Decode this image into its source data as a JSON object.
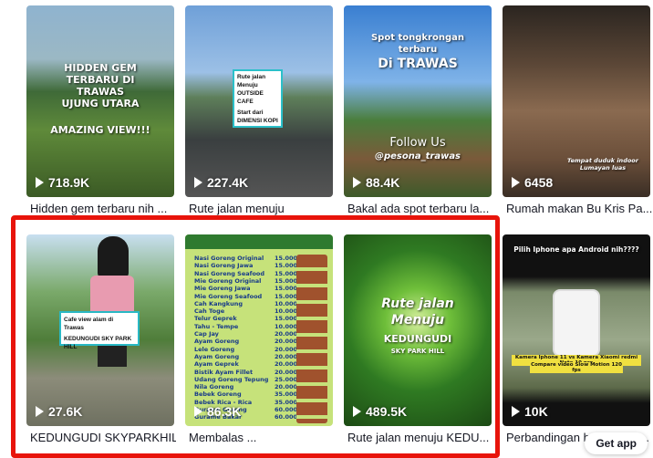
{
  "videos": [
    {
      "views": "718.9K",
      "caption": "Hidden gem terbaru nih ...",
      "overlay": [
        "HIDDEN GEM",
        "TERBARU DI",
        "TRAWAS",
        "UJUNG UTARA",
        "AMAZING VIEW!!!"
      ]
    },
    {
      "views": "227.4K",
      "caption": "Rute jalan menuju",
      "overlay": [
        "Rute jalan",
        "Menuju",
        "OUTSIDE CAFE",
        "Start dari",
        "DIMENSI KOPI"
      ]
    },
    {
      "views": "88.4K",
      "caption": "Bakal ada spot terbaru la...",
      "overlay": [
        "Spot tongkrongan",
        "terbaru",
        "Di TRAWAS",
        "Follow Us",
        "@pesona_trawas"
      ]
    },
    {
      "views": "6458",
      "caption": "Rumah makan Bu Kris Pa...",
      "overlay": [
        "Tempat duduk indoor",
        "Lumayan luas"
      ]
    },
    {
      "views": "27.6K",
      "caption": "KEDUNGUDI SKYPARKHILL",
      "overlay": [
        "Cafe view alam di Trawas",
        "KEDUNGUDI SKY PARK HILL"
      ]
    },
    {
      "views": "86.3K",
      "caption": "Membalas ...",
      "overlay": [
        "Nasi Goreng Original",
        "Nasi Goreng Jawa",
        "Nasi Goreng Seafood",
        "Mie Goreng Original",
        "Mie Goreng Jawa",
        "Mie Goreng Seafood",
        "Cah Kangkung",
        "Cah Toge",
        "Telur Geprek",
        "Tahu - Tempe",
        "Cap Jay",
        "Ayam Goreng",
        "Lele Goreng",
        "Ayam Goreng",
        "Ayam Geprek",
        "Bistik Ayam Fillet",
        "Udang Goreng Tepung",
        "Nila Goreng",
        "Bebek Goreng",
        "Bebek Rica - Rica",
        "Gurame Goreng",
        "Gurame Bakar"
      ]
    },
    {
      "views": "489.5K",
      "caption": "Rute jalan menuju KEDU...",
      "overlay": [
        "Rute jalan",
        "Menuju",
        "KEDUNGUDI",
        "SKY PARK HILL"
      ]
    },
    {
      "views": "10K",
      "caption": "Perbandingan hasil video...",
      "overlay": [
        "Pilih Iphone apa Android nih????",
        "Kamera Iphone 11 vs Kamera Xiaomi redmi Note 10 pro",
        "Compare video Slow Motion 120 fps"
      ]
    }
  ],
  "menu_prices": [
    "15.000",
    "15.000",
    "15.000",
    "15.000",
    "15.000",
    "15.000",
    "10.000",
    "10.000",
    "15.000",
    "10.000",
    "20.000",
    "20.000",
    "20.000",
    "20.000",
    "20.000",
    "20.000",
    "25.000",
    "20.000",
    "35.000",
    "35.000",
    "60.000",
    "60.000"
  ],
  "get_app": "Get app",
  "colors": {
    "highlight": "#e8140b",
    "text": "#161823"
  }
}
